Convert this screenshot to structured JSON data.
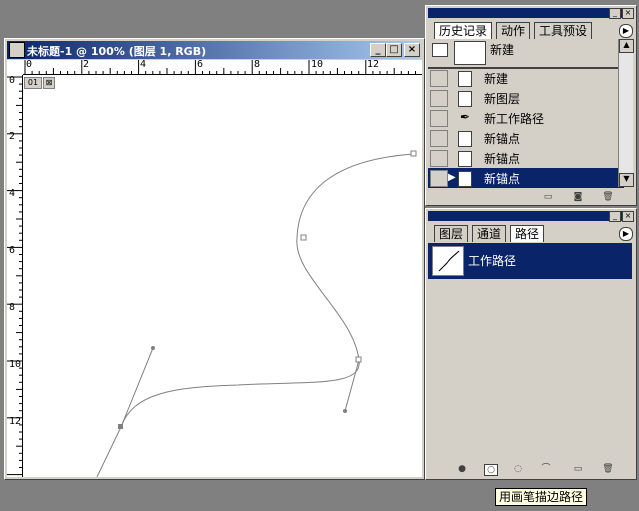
{
  "document": {
    "title": "未标题-1 @ 100% (图层 1, RGB)",
    "win_buttons": {
      "minimize": "_",
      "maximize": "□",
      "close": "×"
    },
    "ruler_h_labels": [
      "0",
      "2",
      "4",
      "6",
      "8",
      "10",
      "12"
    ],
    "ruler_v_labels": [
      "0",
      "2",
      "4",
      "6",
      "8",
      "10",
      "12"
    ],
    "badge1": "01",
    "badge2": "⊠"
  },
  "history_panel": {
    "tabs": [
      "历史记录",
      "动作",
      "工具预设"
    ],
    "snapshot_label": "新建",
    "items": [
      {
        "label": "新建",
        "icon": "history-state-icon"
      },
      {
        "label": "新图层",
        "icon": "history-state-icon"
      },
      {
        "label": "新工作路径",
        "icon": "pen-icon"
      },
      {
        "label": "新锚点",
        "icon": "history-state-icon"
      },
      {
        "label": "新锚点",
        "icon": "history-state-icon"
      },
      {
        "label": "新锚点",
        "icon": "history-state-icon",
        "selected": true
      }
    ]
  },
  "paths_panel": {
    "tabs": [
      "图层",
      "通道",
      "路径"
    ],
    "active_tab": "路径",
    "items": [
      {
        "label": "工作路径",
        "selected": true
      }
    ]
  },
  "tooltip": "用画笔描边路径",
  "colors": {
    "selection": "#0a246a",
    "panel": "#d4d0c8",
    "desktop": "#808080"
  }
}
